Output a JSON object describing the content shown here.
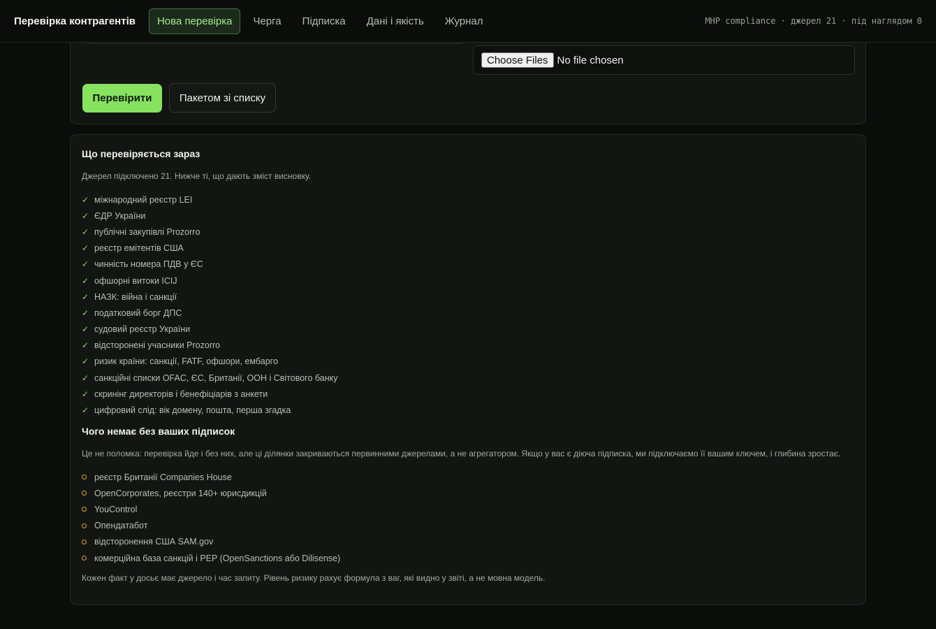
{
  "header": {
    "brand": "Перевірка контрагентів",
    "tabs": [
      {
        "label": "Нова перевірка",
        "active": true
      },
      {
        "label": "Черга"
      },
      {
        "label": "Підписка"
      },
      {
        "label": "Дані і якість"
      },
      {
        "label": "Журнал"
      }
    ],
    "meta": "MHP compliance · джерел 21 · під наглядом 0"
  },
  "form": {
    "file_button": "Choose Files",
    "file_status": "No file chosen",
    "check_button": "Перевірити",
    "batch_button": "Пакетом зі списку"
  },
  "sources": {
    "title_now": "Що перевіряється зараз",
    "intro": "Джерел підключено 21. Нижче ті, що дають зміст висновку.",
    "connected": [
      "міжнародний реєстр LEI",
      "ЄДР України",
      "публічні закупівлі Prozorro",
      "реєстр емітентів США",
      "чинність номера ПДВ у ЄС",
      "офшорні витоки ICIJ",
      "НАЗК: війна і санкції",
      "податковий борг ДПС",
      "судовий реєстр України",
      "відсторонені учасники Prozorro",
      "ризик країни: санкції, FATF, офшори, ембарго",
      "санкційні списки OFAC, ЄС, Британії, ООН і Світового банку",
      "скринінг директорів і бенефіціарів з анкети",
      "цифровий слід: вік домену, пошта, перша згадка"
    ],
    "title_missing": "Чого немає без ваших підписок",
    "missing_intro": "Це не поломка: перевірка йде і без них, але ці ділянки закриваються первинними джерелами, а не агрегатором. Якщо у вас є діюча підписка, ми підключаємо її вашим ключем, і глибина зростає.",
    "missing": [
      "реєстр Британії Companies House",
      "OpenCorporates, реєстри 140+ юрисдикцій",
      "YouControl",
      "Опендатабот",
      "відсторонення США SAM.gov",
      "комерційна база санкцій і PEP (OpenSanctions або Dilisense)"
    ],
    "footer": "Кожен факт у досьє має джерело і час запиту. Рівень ризику рахує формула з ваг, які видно у звіті, а не мовна модель."
  },
  "colors": {
    "accent": "#86e25f",
    "warning": "#e6a03a",
    "background": "#0b0d0b"
  }
}
